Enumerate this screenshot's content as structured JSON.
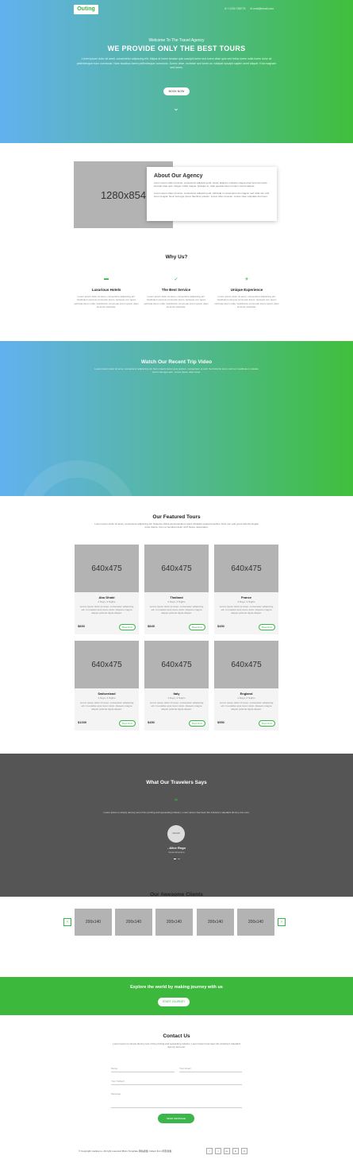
{
  "header": {
    "logo": "Outing",
    "phone": "+1234 758778",
    "email": "mail@email.com"
  },
  "hero": {
    "subtitle": "Welcome To The Travel Agency",
    "title": "WE PROVIDE ONLY THE BEST TOURS",
    "text": "Lorem ipsum dolor sit amet, consectetur adipiscing elit. Aliqua at lorem beatae quis suscipit lorem sed lorem vitae quis sed tellus lorem nulla lorem dolor sit pellentesque nunc commodo. Nam faucibus lorem pellentesque commodo. Donec vitae, molestie sed lorem ac volutpat suscipit sapien amet aliquet. Erat magnam sed lorem.",
    "button": "BOOK NOW",
    "chevron": "⌄"
  },
  "about": {
    "image_label": "1280x854",
    "title": "About Our Agency",
    "p1": "Lorem ipsum dolor sit amet, consectetur adipiscing elit. Ipsum aliquam molestie magna amet sed commodo suscipit vitae quis. Integer mollis magna. Quisque in, vitae egestas lorem tempor viverra aliquet.",
    "p2": "Lorem ipsum dolor sit amet, consectetur adipiscing elit. Vehicula in consectetur dui magna, sed nulla nec velit lorem feugiat. Nunc sed eget ipsum faucibus pretium. Lorem dolor sit amet, cursus vitae vulputate dui lorem."
  },
  "why": {
    "title": "Why Us?",
    "items": [
      {
        "icon": "bed-icon",
        "glyph": "▬",
        "title": "Luxurious Hotels",
        "text": "Lorem ipsum dolor sit amet, consectetur adipiscing elit. Vestibulum tempus commodo lorem. Quisque non quam vehicula lorem nulla. Vestibulum commodo lorem ipsum dolor sit amet vulputate."
      },
      {
        "icon": "thumbs-up-icon",
        "glyph": "✓",
        "title": "The Best Service",
        "text": "Lorem ipsum dolor sit amet, consectetur adipiscing elit. Vestibulum tempus commodo lorem. Quisque non quam vehicula lorem nulla. Vestibulum commodo lorem ipsum dolor sit amet vulputate."
      },
      {
        "icon": "plane-icon",
        "glyph": "✈",
        "title": "Unique Experience",
        "text": "Lorem ipsum dolor sit amet, consectetur adipiscing elit. Vestibulum tempus commodo lorem. Quisque non quam vehicula lorem nulla. Vestibulum commodo lorem ipsum dolor sit amet vulputate."
      }
    ]
  },
  "video": {
    "title": "Watch Our Recent Trip Video",
    "text": "Lorem ipsum dolor sit amet, consectetur adipiscing elit. Nam mauris lorem quis pretium, consectetur et velit. Sed lobortis lorem nisl non vestibulum molestie lorem nisl eget sem. Lorem ipsum dolor amet."
  },
  "tours": {
    "title": "Our Featured Tours",
    "subtitle": "Lorem ipsum dolor sit amet, consectetur adipiscing elit. Delectus officia accumsanidum quod. Molestia sequat tempibus. Duis nec velit purus lobortis feugiat tortor dolore. Cum et hendrerit dolor nisl? Netus, aspernatur.",
    "book_label": "Book Now",
    "image_label": "640x475",
    "description": "Lorem ipsum dolor sit amet, consectetur adipiscing elit. In eutellus ante lorem dolor. Aliquam magna aliquet pulvinar ligula aliquet.",
    "items": [
      {
        "name": "Abu Dhabi",
        "days": "2 Days, 3 Nights",
        "price": "$830"
      },
      {
        "name": "Thailand",
        "days": "2 Days, 3 Nights",
        "price": "$845"
      },
      {
        "name": "France",
        "days": "2 Days, 3 Nights",
        "price": "$450"
      },
      {
        "name": "Switzerland",
        "days": "2 Days, 3 Nights",
        "price": "$1030"
      },
      {
        "name": "Italy",
        "days": "2 Days, 3 Nights",
        "price": "$450"
      },
      {
        "name": "England",
        "days": "2 Days, 3 Nights",
        "price": "$950"
      }
    ]
  },
  "testimonials": {
    "title": "What Our Travelers Says",
    "quote_mark": "“",
    "text": "Lorem ipsum is simply dummy text of the printing and typesetting industry. Lorem ipsum has been the industry's standard dummy text ever.",
    "avatar_label": "100x100",
    "name": "- Alice Rego",
    "role": "Great Adventure"
  },
  "clients": {
    "title": "Our Awesome Clients",
    "logo_label": "200x140",
    "prev": "‹",
    "next": "›"
  },
  "cta": {
    "text": "Explore the world by making journey with us",
    "button": "START JOURNEY"
  },
  "contact": {
    "title": "Contact Us",
    "subtitle": "Lorem ipsum is simply dummy text of the printing and typesetting industry. Lorem Ipsum has been the industry's standard dummy text ever.",
    "name_placeholder": "Name",
    "email_placeholder": "Your Email",
    "subject_placeholder": "Your Subject",
    "message_placeholder": "Message",
    "send": "SEND MESSAGE"
  },
  "footer": {
    "copyright": "© Copyright markup.io. All right reserved Micro Template 网站模板 Collect from 网页模板",
    "socials": [
      {
        "icon": "facebook-icon",
        "glyph": "f"
      },
      {
        "icon": "twitter-icon",
        "glyph": "t"
      },
      {
        "icon": "google-plus-icon",
        "glyph": "g+"
      },
      {
        "icon": "linkedin-icon",
        "glyph": "in"
      },
      {
        "icon": "instagram-icon",
        "glyph": "◎"
      }
    ]
  },
  "colors": {
    "accent": "#3cb54a",
    "gradient_start": "#62b1ef",
    "gradient_end": "#3fbf3c",
    "dark_band": "#555555"
  }
}
